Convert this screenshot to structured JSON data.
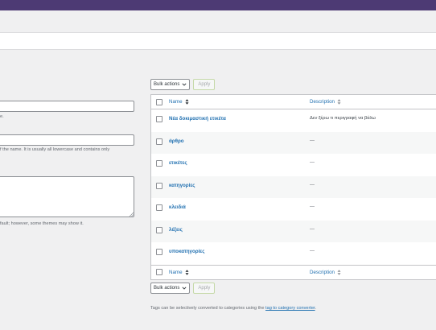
{
  "colors": {
    "admin_bar": "#4d3a74",
    "link": "#2271b1",
    "border": "#c3c4c7",
    "background": "#f0f0f1"
  },
  "form": {
    "name_help": "e.",
    "slug_help": "f the name. It is usually all lowercase and contains only",
    "description_help": "fault; however, some themes may show it."
  },
  "bulk": {
    "select_label": "Bulk actions",
    "apply_label": "Apply"
  },
  "table": {
    "columns": {
      "name": "Name",
      "description": "Description"
    },
    "rows": [
      {
        "name": "Νέα δοκιμαστική ετικέτα",
        "description": "Δεν ξέρω τι περιγραφή να βάλω"
      },
      {
        "name": "άρθρο",
        "description": "—"
      },
      {
        "name": "ετικέτες",
        "description": "—"
      },
      {
        "name": "κατηγορίες",
        "description": "—"
      },
      {
        "name": "κλειδιά",
        "description": "—"
      },
      {
        "name": "λέξεις",
        "description": "—"
      },
      {
        "name": "υποκατηγορίες",
        "description": "—"
      }
    ]
  },
  "footer": {
    "text": "Tags can be selectively converted to categories using the ",
    "link": "tag to category converter",
    "end": "."
  },
  "icons": [
    "sort-icon",
    "chevron-down-icon",
    "resize-grip-icon"
  ]
}
